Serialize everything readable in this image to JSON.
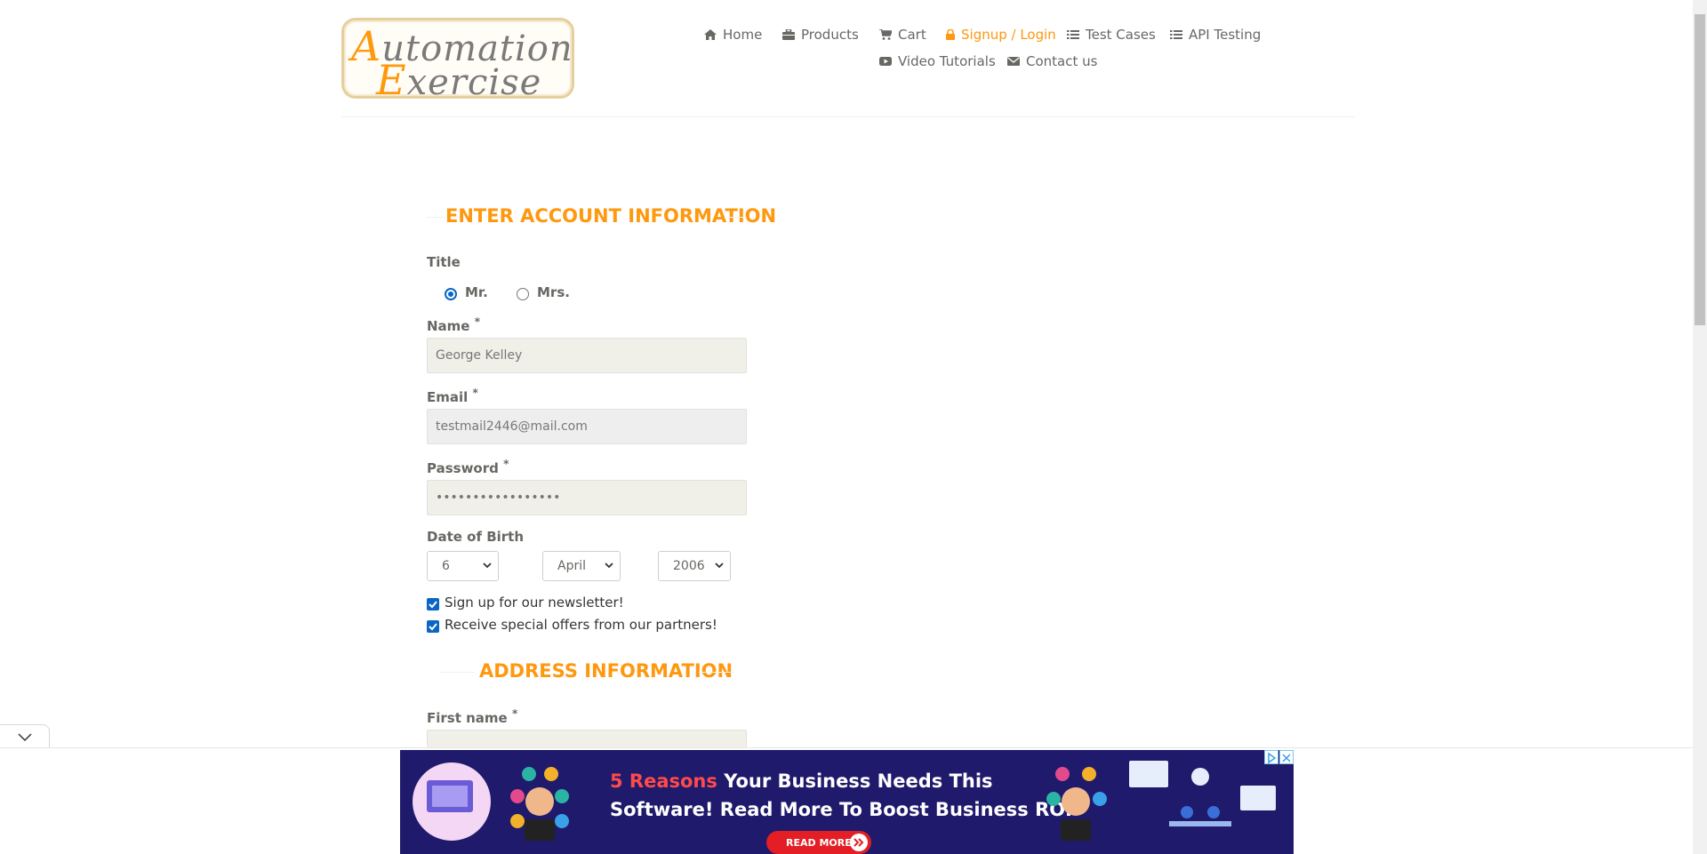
{
  "logo": {
    "line1_cap": "A",
    "line1_rest": "utomation",
    "line2_cap": "E",
    "line2_rest": "xercise"
  },
  "nav": [
    {
      "label": "Home",
      "icon": "home-icon"
    },
    {
      "label": "Products",
      "icon": "products-icon"
    },
    {
      "label": "Cart",
      "icon": "cart-icon"
    },
    {
      "label": "Signup / Login",
      "icon": "lock-icon",
      "active": true
    },
    {
      "label": "Test Cases",
      "icon": "list-icon"
    },
    {
      "label": "API Testing",
      "icon": "list-icon"
    },
    {
      "label": "Video Tutorials",
      "icon": "youtube-icon"
    },
    {
      "label": "Contact us",
      "icon": "envelope-icon"
    }
  ],
  "form": {
    "heading": "ENTER ACCOUNT INFORMATION",
    "title_label": "Title",
    "title_options": [
      "Mr.",
      "Mrs."
    ],
    "selected_title": "Mr.",
    "name_label": "Name",
    "name_value": "George Kelley",
    "email_label": "Email",
    "email_value": "testmail2446@mail.com",
    "password_label": "Password",
    "password_value": "•••••••••••••••••",
    "required_mark": "*",
    "dob_label": "Date of Birth",
    "dob_day": "6",
    "dob_month": "April",
    "dob_year": "2006",
    "newsletter_label": "Sign up for our newsletter!",
    "newsletter_checked": true,
    "offers_label": "Receive special offers from our partners!",
    "offers_checked": true,
    "address_heading": "ADDRESS INFORMATION",
    "first_name_label": "First name"
  },
  "ad": {
    "line1_highlight": "5 Reasons",
    "line1_rest": " Your Business Needs This",
    "line2": "Software! Read More To Boost Business ROI",
    "button_label": "READ MORE"
  },
  "colors": {
    "accent": "#fe980f",
    "text": "#696763",
    "input_bg": "#f0f0e9",
    "checkbox": "#0a66c2",
    "ad_bg": "#1f1a6b",
    "ad_button": "#e31e24"
  }
}
